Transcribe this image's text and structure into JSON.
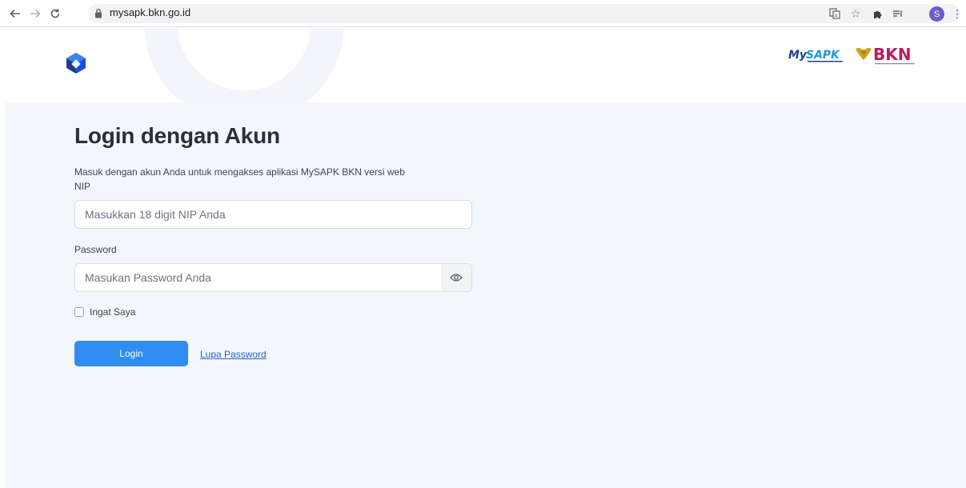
{
  "browser": {
    "url": "mysapk.bkn.go.id",
    "profile_initial": "S"
  },
  "header": {
    "brand_logo_1": "MySAPK",
    "brand_logo_2": "BKN"
  },
  "login": {
    "title": "Login dengan Akun",
    "subtitle": "Masuk dengan akun Anda untuk mengakses aplikasi MySAPK BKN versi web",
    "nip_label": "NIP",
    "nip_placeholder": "Masukkan 18 digit NIP Anda",
    "password_label": "Password",
    "password_placeholder": "Masukan Password Anda",
    "remember_label": "Ingat Saya",
    "login_button": "Login",
    "forgot_link": "Lupa Password"
  },
  "colors": {
    "primary": "#2f8cf0",
    "page_bg": "#f3f6fb",
    "link": "#2563c9"
  }
}
